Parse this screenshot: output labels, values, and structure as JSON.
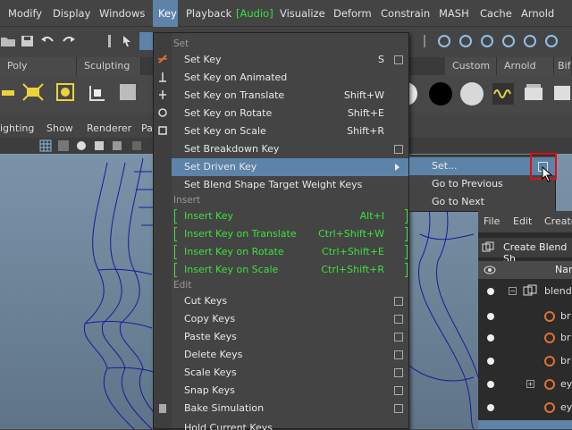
{
  "menubar": {
    "items": [
      "Modify",
      "Display",
      "Windows",
      "Key",
      "Playback",
      "Audio",
      "Visualize",
      "Deform",
      "Constrain",
      "MASH",
      "Cache",
      "Arnold"
    ],
    "active": "Key",
    "open_bracket": "[",
    "close_bracket": "]"
  },
  "shelf_tabs": [
    "Poly Modeling",
    "Sculpting",
    "Custom",
    "Arnold",
    "Bif"
  ],
  "panel_menu": [
    "ighting",
    "Show",
    "Renderer",
    "Pa"
  ],
  "dropdown": {
    "sections": {
      "set": "Set",
      "insert": "Insert",
      "edit": "Edit"
    },
    "set_items": [
      {
        "label": "Set Key",
        "shortcut": "S",
        "option": true
      },
      {
        "label": "Set Key on Animated",
        "shortcut": "",
        "option": false
      },
      {
        "label": "Set Key on Translate",
        "shortcut": "Shift+W",
        "option": false
      },
      {
        "label": "Set Key on Rotate",
        "shortcut": "Shift+E",
        "option": false
      },
      {
        "label": "Set Key on Scale",
        "shortcut": "Shift+R",
        "option": false
      },
      {
        "label": "Set Breakdown Key",
        "shortcut": "",
        "option": true
      },
      {
        "label": "Set Driven Key",
        "shortcut": "",
        "option": false,
        "submenu": true
      },
      {
        "label": "Set Blend Shape Target Weight Keys",
        "shortcut": "",
        "option": false
      }
    ],
    "insert_items": [
      {
        "label": "Insert Key",
        "shortcut": "Alt+I"
      },
      {
        "label": "Insert Key on Translate",
        "shortcut": "Ctrl+Shift+W"
      },
      {
        "label": "Insert Key on Rotate",
        "shortcut": "Ctrl+Shift+E"
      },
      {
        "label": "Insert Key on Scale",
        "shortcut": "Ctrl+Shift+R"
      }
    ],
    "edit_items": [
      {
        "label": "Cut Keys"
      },
      {
        "label": "Copy Keys"
      },
      {
        "label": "Paste Keys"
      },
      {
        "label": "Delete Keys"
      },
      {
        "label": "Scale Keys"
      },
      {
        "label": "Snap Keys"
      },
      {
        "label": "Bake Simulation"
      },
      {
        "label": "Hold Current Keys"
      }
    ]
  },
  "submenu": {
    "items": [
      "Set...",
      "Go to Previous",
      "Go to Next"
    ]
  },
  "outliner": {
    "menu": [
      "File",
      "Edit",
      "Create"
    ],
    "title": "Create Blend Sh",
    "header": "Nar",
    "rows": [
      "blend",
      "br",
      "br",
      "br",
      "ey",
      "ey"
    ]
  },
  "colors": {
    "accent": "#5d83a8",
    "highlight_green": "#3ce03c",
    "callout_red": "#e01010"
  }
}
